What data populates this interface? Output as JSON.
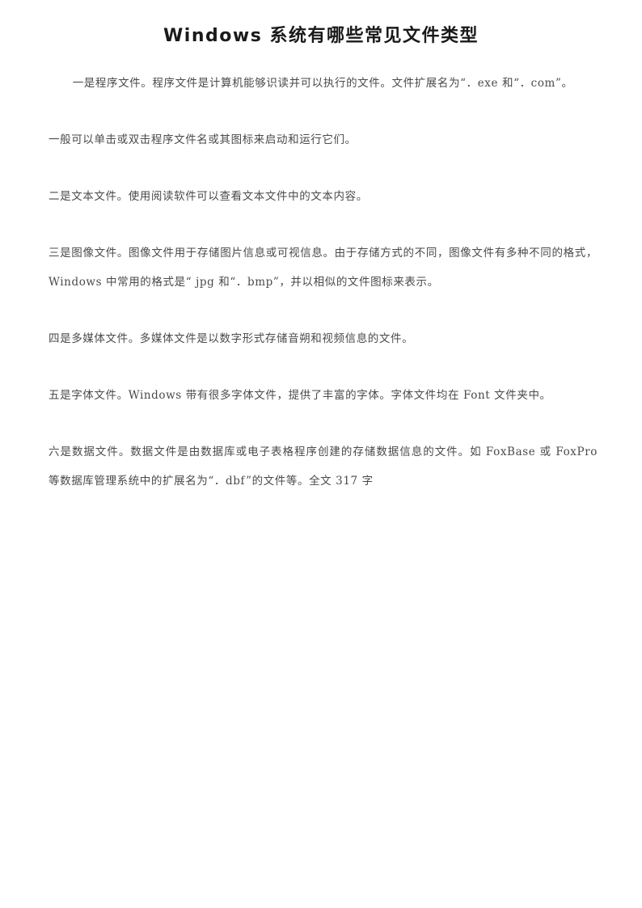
{
  "document": {
    "title": "Windows 系统有哪些常见文件类型",
    "page_background": "#ffffff",
    "title_color": "#1a1a1a",
    "body_color": "#4a4a4a",
    "paragraphs": [
      {
        "id": "p1-program-files",
        "indent": true,
        "text": "一是程序文件。程序文件是计算机能够识读并可以执行的文件。文件扩展名为“．exe 和“．com”。"
      },
      {
        "id": "p2-launch-run",
        "indent": false,
        "text": "一般可以单击或双击程序文件名或其图标来启动和运行它们。"
      },
      {
        "id": "p3-text-files",
        "indent": false,
        "text": "二是文本文件。使用阅读软件可以查看文本文件中的文本内容。"
      },
      {
        "id": "p4-image-files",
        "indent": false,
        "text": "三是图像文件。图像文件用于存储图片信息或可视信息。由于存储方式的不同，图像文件有多种不同的格式，Windows 中常用的格式是“ jpg 和“．bmp”，并以相似的文件图标来表示。"
      },
      {
        "id": "p5-multimedia-files",
        "indent": false,
        "text": "四是多媒体文件。多媒体文件是以数字形式存储音朔和视频信息的文件。"
      },
      {
        "id": "p6-font-files",
        "indent": false,
        "text": "五是字体文件。Windows 带有很多字体文件，提供了丰富的字体。字体文件均在 Font 文件夹中。"
      },
      {
        "id": "p7-data-files",
        "indent": false,
        "text": "六是数据文件。数据文件是由数据库或电子表格程序创建的存储数据信息的文件。如 FoxBase 或 FoxPro 等数据库管理系统中的扩展名为“．dbf”的文件等。全文 317 字"
      }
    ]
  }
}
